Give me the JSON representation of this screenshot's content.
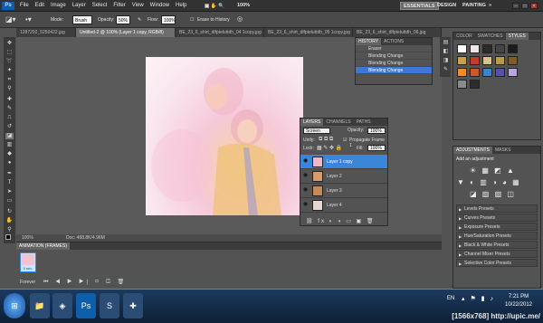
{
  "app": {
    "logo": "Ps",
    "menus": [
      "File",
      "Edit",
      "Image",
      "Layer",
      "Select",
      "Filter",
      "View",
      "Window",
      "Help"
    ],
    "zoom_menu": "100%",
    "workspaces": [
      "ESSENTIALS",
      "DESIGN",
      "PAINTING"
    ],
    "workspace_more": "»"
  },
  "options": {
    "mode_label": "Mode:",
    "mode_value": "Brush",
    "opacity_label": "Opacity:",
    "opacity_value": "50%",
    "flow_label": "Flow:",
    "flow_value": "100%",
    "erase_label": "Erase to History"
  },
  "tabs": [
    "1287292_5250422.jpg",
    "Untitled-2 @ 100% (Layer 1 copy, RGB/8)",
    "BE_23_6_shirt_dlfpteluttdh_04 1copy.jpg",
    "BE_23_6_shirt_dlfpteluttdh_05 1copy.jpg",
    "BE_23_6_shirt_dlfpteluttdh_06.jpg"
  ],
  "status": {
    "zoom": "100%",
    "doc": "Doc: 468.8K/4.96M"
  },
  "history": {
    "tabs": [
      "HISTORY",
      "ACTIONS"
    ],
    "items": [
      "Eraser",
      "Blending Change",
      "Blending Change",
      "Blending Change"
    ]
  },
  "layers": {
    "tabs": [
      "LAYERS",
      "CHANNELS",
      "PATHS"
    ],
    "blend": "Screen",
    "opacity_label": "Opacity:",
    "opacity": "100%",
    "unify_label": "Unify:",
    "propagate_label": "Propagate Frame 1",
    "lock_label": "Lock:",
    "fill_label": "Fill:",
    "fill": "100%",
    "items": [
      "Layer 1 copy",
      "Layer 2",
      "Layer 3",
      "Layer 4"
    ]
  },
  "color_panel": {
    "tabs": [
      "COLOR",
      "SWATCHES",
      "STYLES"
    ]
  },
  "adjustments": {
    "tabs": [
      "ADJUSTMENTS",
      "MASKS"
    ],
    "title": "Add an adjustment",
    "presets": [
      "Levels Presets",
      "Curves Presets",
      "Exposure Presets",
      "Hue/Saturation Presets",
      "Black & White Presets",
      "Channel Mixer Presets",
      "Selective Color Presets"
    ]
  },
  "animation": {
    "title": "ANIMATION (FRAMES)",
    "frame_time": "0 sec.",
    "loop": "Forever"
  },
  "taskbar": {
    "lang": "EN",
    "time": "7:21 PM",
    "date": "10/22/2012"
  },
  "watermark": "[1566x768] http://upic.me/",
  "colors": {
    "menubar": "#323232",
    "selected": "#3a86d8",
    "canvas_bg": "#5a5a5a"
  }
}
